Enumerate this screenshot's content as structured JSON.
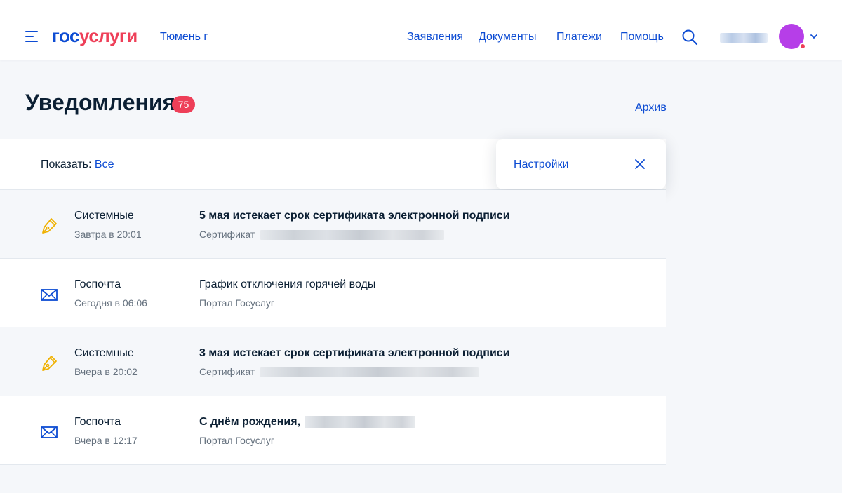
{
  "header": {
    "logo_part1": "гос",
    "logo_part2": "услуги",
    "city": "Тюмень г",
    "nav": [
      "Заявления",
      "Документы",
      "Платежи",
      "Помощь"
    ],
    "icons": {
      "menu": "menu-icon",
      "search": "search-icon",
      "chevron": "chevron-down-icon"
    },
    "avatar_color": "#b63ee8",
    "notification_dot_color": "#ee3f58"
  },
  "page": {
    "title": "Уведомления",
    "badge_count": "75",
    "archive_label": "Архив"
  },
  "filter": {
    "show_label": "Показать:",
    "show_value": "Все",
    "settings_label": "Настройки"
  },
  "colors": {
    "accent": "#0d4cd3",
    "brand_red": "#ee3f58",
    "pen_icon": "#f0b100"
  },
  "notifications": [
    {
      "icon": "pen-icon",
      "category": "Системные",
      "time": "Завтра в 20:01",
      "title": "5 мая истекает срок сертификата электронной подписи",
      "subtitle": "Сертификат",
      "bold": true
    },
    {
      "icon": "envelope-icon",
      "category": "Госпочта",
      "time": "Сегодня в 06:06",
      "title": "График отключения горячей воды",
      "subtitle": "Портал Госуслуг",
      "bold": false
    },
    {
      "icon": "pen-icon",
      "category": "Системные",
      "time": "Вчера в 20:02",
      "title": "3 мая истекает срок сертификата электронной подписи",
      "subtitle": "Сертификат",
      "bold": true
    },
    {
      "icon": "envelope-icon",
      "category": "Госпочта",
      "time": "Вчера в 12:17",
      "title": "С днём рождения,",
      "subtitle": "Портал Госуслуг",
      "bold": true
    }
  ]
}
